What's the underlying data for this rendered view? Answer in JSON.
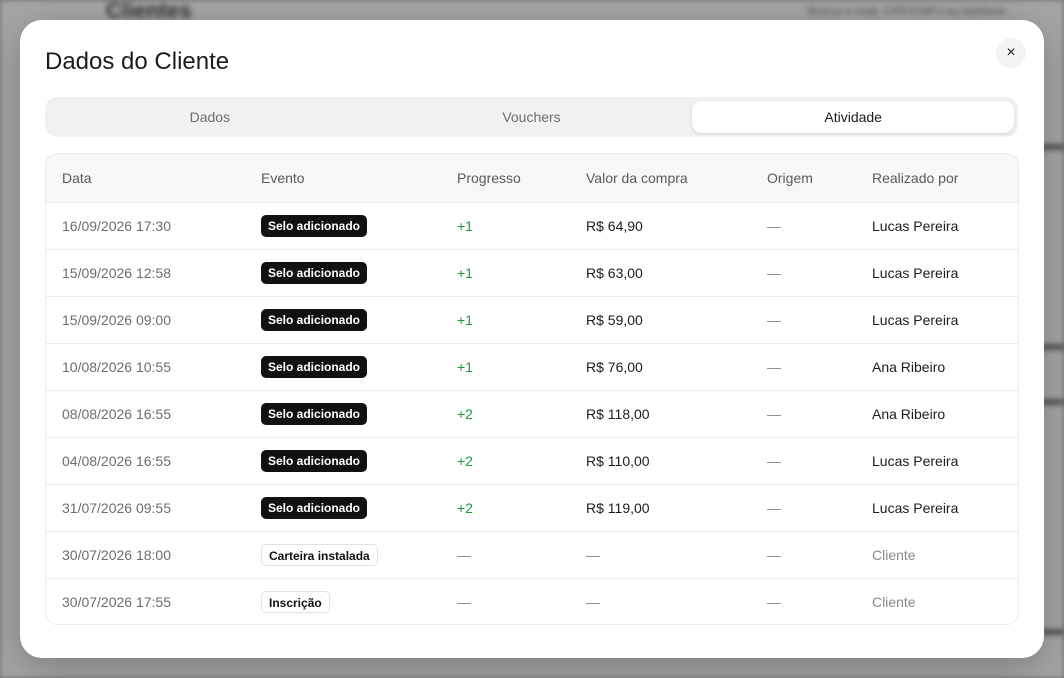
{
  "background": {
    "title": "Clientes",
    "search_hint": "Busca e-mail, CPF/CNPJ ou telefone"
  },
  "modal": {
    "title": "Dados do Cliente",
    "close_icon": "×"
  },
  "tabs": [
    {
      "label": "Dados",
      "active": false
    },
    {
      "label": "Vouchers",
      "active": false
    },
    {
      "label": "Atividade",
      "active": true
    }
  ],
  "table": {
    "columns": [
      "Data",
      "Evento",
      "Progresso",
      "Valor da compra",
      "Origem",
      "Realizado por"
    ],
    "rows": [
      {
        "date": "16/09/2026 17:30",
        "event": "Selo adicionado",
        "event_style": "dark",
        "progress": "+1",
        "value": "R$ 64,90",
        "origin": "—",
        "by": "Lucas Pereira"
      },
      {
        "date": "15/09/2026 12:58",
        "event": "Selo adicionado",
        "event_style": "dark",
        "progress": "+1",
        "value": "R$ 63,00",
        "origin": "—",
        "by": "Lucas Pereira"
      },
      {
        "date": "15/09/2026 09:00",
        "event": "Selo adicionado",
        "event_style": "dark",
        "progress": "+1",
        "value": "R$ 59,00",
        "origin": "—",
        "by": "Lucas Pereira"
      },
      {
        "date": "10/08/2026 10:55",
        "event": "Selo adicionado",
        "event_style": "dark",
        "progress": "+1",
        "value": "R$ 76,00",
        "origin": "—",
        "by": "Ana Ribeiro"
      },
      {
        "date": "08/08/2026 16:55",
        "event": "Selo adicionado",
        "event_style": "dark",
        "progress": "+2",
        "value": "R$ 118,00",
        "origin": "—",
        "by": "Ana Ribeiro"
      },
      {
        "date": "04/08/2026 16:55",
        "event": "Selo adicionado",
        "event_style": "dark",
        "progress": "+2",
        "value": "R$ 110,00",
        "origin": "—",
        "by": "Lucas Pereira"
      },
      {
        "date": "31/07/2026 09:55",
        "event": "Selo adicionado",
        "event_style": "dark",
        "progress": "+2",
        "value": "R$ 119,00",
        "origin": "—",
        "by": "Lucas Pereira"
      },
      {
        "date": "30/07/2026 18:00",
        "event": "Carteira instalada",
        "event_style": "light",
        "progress": "—",
        "value": "—",
        "origin": "—",
        "by": "Cliente"
      },
      {
        "date": "30/07/2026 17:55",
        "event": "Inscrição",
        "event_style": "light",
        "progress": "—",
        "value": "—",
        "origin": "—",
        "by": "Cliente"
      }
    ]
  },
  "colors": {
    "positive_progress": "#1c9a3a",
    "badge_dark": "#111111",
    "muted_text": "#6d6d6d"
  }
}
